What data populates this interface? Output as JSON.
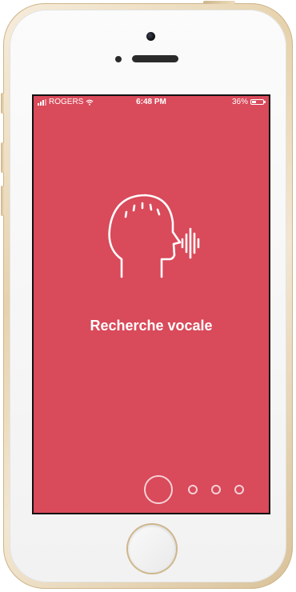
{
  "status_bar": {
    "carrier": "ROGERS",
    "time": "6:48 PM",
    "battery_percent_label": "36%",
    "battery_level": 0.36,
    "icons": [
      "signal-icon",
      "wifi-icon",
      "battery-icon"
    ]
  },
  "onboarding": {
    "icon": "voice-search-head-icon",
    "title": "Recherche vocale",
    "page_count": 4,
    "current_page": 1
  },
  "colors": {
    "screen_background": "#d94a5a",
    "foreground": "#ffffff",
    "phone_frame": "#e6d2ad"
  }
}
